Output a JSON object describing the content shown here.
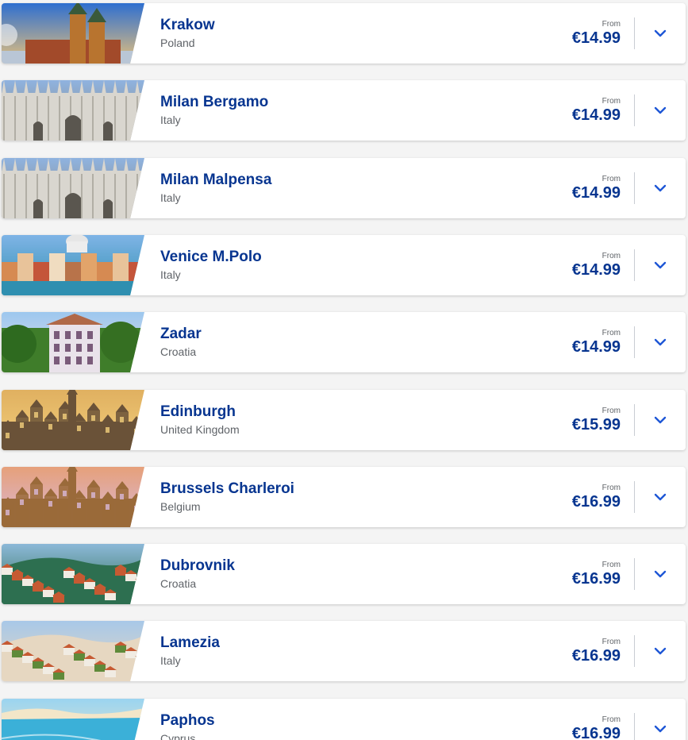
{
  "from_label": "From",
  "destinations": [
    {
      "city": "Krakow",
      "country": "Poland",
      "price": "€14.99",
      "image": "krakow-church-towers",
      "sky": "#2f6fd0",
      "ground": "#b8742f",
      "accent": "#e9c27a"
    },
    {
      "city": "Milan Bergamo",
      "country": "Italy",
      "price": "€14.99",
      "image": "milan-duomo",
      "sky": "#8fb3e0",
      "ground": "#d9d6cf",
      "accent": "#8a857c"
    },
    {
      "city": "Milan Malpensa",
      "country": "Italy",
      "price": "€14.99",
      "image": "milan-duomo",
      "sky": "#8fb3e0",
      "ground": "#d9d6cf",
      "accent": "#8a857c"
    },
    {
      "city": "Venice M.Polo",
      "country": "Italy",
      "price": "€14.99",
      "image": "venice-grand-canal",
      "sky": "#7fb4e6",
      "ground": "#d68a52",
      "accent": "#2f8fb0"
    },
    {
      "city": "Zadar",
      "country": "Croatia",
      "price": "€14.99",
      "image": "zadar-villa-trees",
      "sky": "#9cc7ee",
      "ground": "#3f7d2a",
      "accent": "#e9e2ea"
    },
    {
      "city": "Edinburgh",
      "country": "United Kingdom",
      "price": "€15.99",
      "image": "edinburgh-skyline",
      "sky": "#e0b060",
      "ground": "#6a5238",
      "accent": "#f2cf7c"
    },
    {
      "city": "Brussels Charleroi",
      "country": "Belgium",
      "price": "€16.99",
      "image": "brussels-grand-place",
      "sky": "#e6a07a",
      "ground": "#9a6a3a",
      "accent": "#d8b8d8"
    },
    {
      "city": "Dubrovnik",
      "country": "Croatia",
      "price": "€16.99",
      "image": "dubrovnik-old-town",
      "sky": "#8cb8d8",
      "ground": "#c65a32",
      "accent": "#2d6f50"
    },
    {
      "city": "Lamezia",
      "country": "Italy",
      "price": "€16.99",
      "image": "lamezia-hillside",
      "sky": "#a8c8e8",
      "ground": "#5f8a3a",
      "accent": "#e6d7c1"
    },
    {
      "city": "Paphos",
      "country": "Cyprus",
      "price": "€16.99",
      "image": "paphos-sea",
      "sky": "#9ad4f0",
      "ground": "#3bb0d8",
      "accent": "#f3e6c8"
    }
  ]
}
